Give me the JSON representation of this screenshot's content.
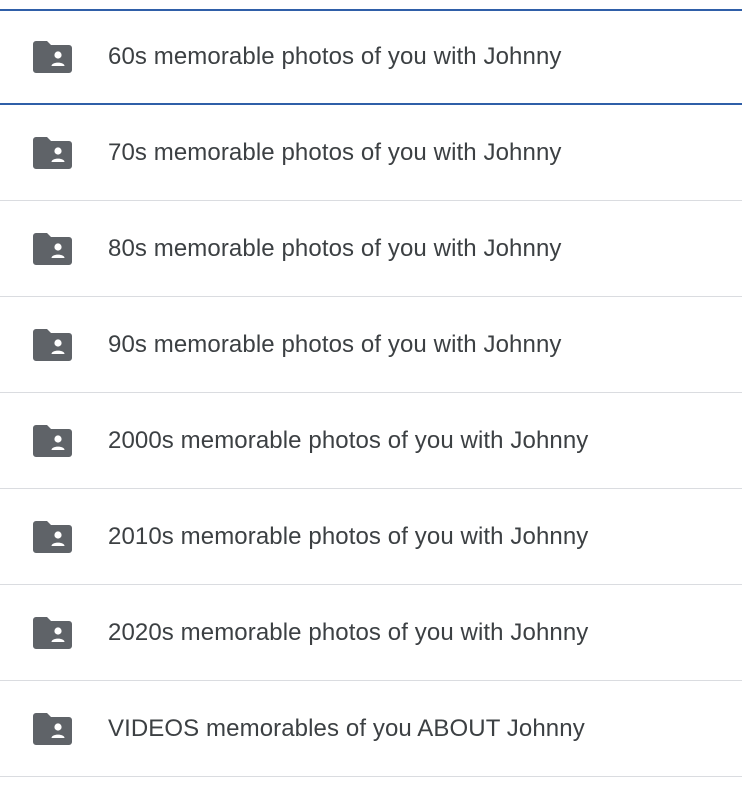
{
  "folders": [
    {
      "label": "60s memorable photos of you with Johnny",
      "icon": "shared-folder-icon",
      "selected": true
    },
    {
      "label": "70s memorable photos of you with Johnny",
      "icon": "shared-folder-icon"
    },
    {
      "label": "80s memorable photos of you with Johnny",
      "icon": "shared-folder-icon"
    },
    {
      "label": "90s memorable photos of you with Johnny",
      "icon": "shared-folder-icon"
    },
    {
      "label": "2000s memorable photos of you with Johnny",
      "icon": "shared-folder-icon"
    },
    {
      "label": "2010s memorable photos of you with Johnny",
      "icon": "shared-folder-icon"
    },
    {
      "label": "2020s memorable photos of you with Johnny",
      "icon": "shared-folder-icon"
    },
    {
      "label": "VIDEOS memorables of you ABOUT Johnny",
      "icon": "shared-folder-icon"
    }
  ],
  "colors": {
    "icon": "#5f6368",
    "text": "#3c4043",
    "divider": "#dadce0",
    "selected_border": "#2f5fa8"
  }
}
